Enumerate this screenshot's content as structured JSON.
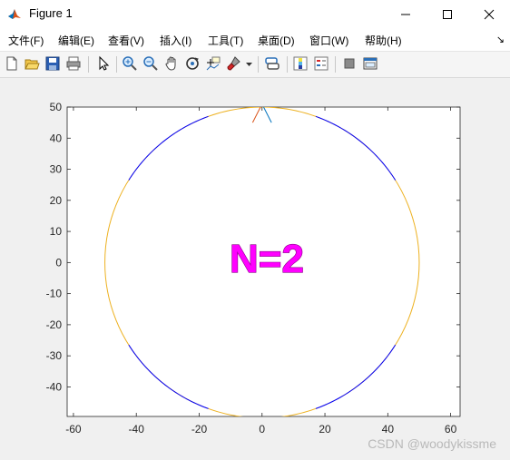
{
  "window": {
    "title": "Figure 1"
  },
  "menu": [
    "文件(F)",
    "编辑(E)",
    "查看(V)",
    "插入(I)",
    "工具(T)",
    "桌面(D)",
    "窗口(W)",
    "帮助(H)"
  ],
  "toolbar_icons": [
    "new-figure-icon",
    "open-file-icon",
    "save-icon",
    "print-icon",
    "pointer-icon",
    "zoom-in-icon",
    "zoom-out-icon",
    "pan-hand-icon",
    "rotate-3d-icon",
    "data-cursor-icon",
    "brush-icon",
    "dropdown-arrow-icon",
    "link-plot-icon",
    "colorbar-icon",
    "legend-icon",
    "hide-plot-tools-icon",
    "show-plot-tools-icon"
  ],
  "annotation": "N=2",
  "watermark": "CSDN @woodykissme",
  "chart_data": {
    "type": "line",
    "xlim": [
      -62,
      63
    ],
    "ylim": [
      -49.5,
      50
    ],
    "xticks": [
      -60,
      -40,
      -20,
      0,
      20,
      40,
      60
    ],
    "yticks": [
      -40,
      -30,
      -20,
      -10,
      0,
      10,
      20,
      30,
      40,
      50
    ],
    "grid": false,
    "colors": {
      "circle": "#edb120",
      "arcs": "#0000ff",
      "spike_left": "#d95319",
      "spike_right": "#0072bd"
    },
    "circle": {
      "cx": 0,
      "cy": 0,
      "r": 50
    },
    "arcs": [
      {
        "r": 50,
        "from_deg": 32,
        "to_deg": 70
      },
      {
        "r": 50,
        "from_deg": 110,
        "to_deg": 148
      },
      {
        "r": 50,
        "from_deg": 212,
        "to_deg": 250
      },
      {
        "r": 50,
        "from_deg": 290,
        "to_deg": 328
      }
    ],
    "spikes": [
      {
        "points": [
          [
            -3,
            45
          ],
          [
            -0.5,
            50
          ]
        ]
      },
      {
        "points": [
          [
            0.5,
            50
          ],
          [
            3,
            45
          ]
        ]
      }
    ]
  }
}
